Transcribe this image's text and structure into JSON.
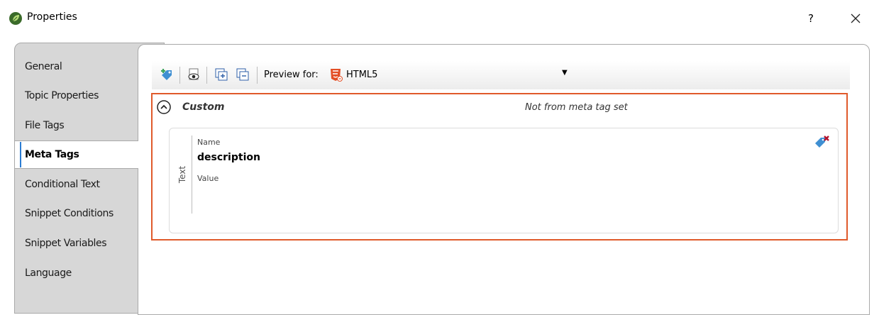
{
  "window": {
    "title": "Properties",
    "help_label": "?",
    "app_icon": "leaf-icon",
    "close_icon": "close-icon"
  },
  "tabs": [
    {
      "label": "General",
      "active": false
    },
    {
      "label": "Topic Properties",
      "active": false
    },
    {
      "label": "File Tags",
      "active": false
    },
    {
      "label": "Meta Tags",
      "active": true
    },
    {
      "label": "Conditional Text",
      "active": false
    },
    {
      "label": "Snippet Conditions",
      "active": false
    },
    {
      "label": "Snippet Variables",
      "active": false
    },
    {
      "label": "Language",
      "active": false
    }
  ],
  "toolbar": {
    "buttons": [
      "add-meta-tag-icon",
      "preview-icon",
      "expand-all-icon",
      "collapse-all-icon"
    ],
    "preview_label": "Preview for:",
    "preview_value": "HTML5",
    "preview_icon": "html5-icon"
  },
  "section": {
    "title": "Custom",
    "note": "Not from meta tag set",
    "collapse_icon": "chevron-up-circle-icon"
  },
  "meta_tag": {
    "type_label": "Text",
    "name_label": "Name",
    "name_value": "description",
    "value_label": "Value",
    "value": "",
    "delete_icon": "delete-tag-icon"
  },
  "colors": {
    "highlight": "#e05a2b",
    "active_tab_accent": "#2b7cd3",
    "panel_gray": "#d7d7d7"
  }
}
